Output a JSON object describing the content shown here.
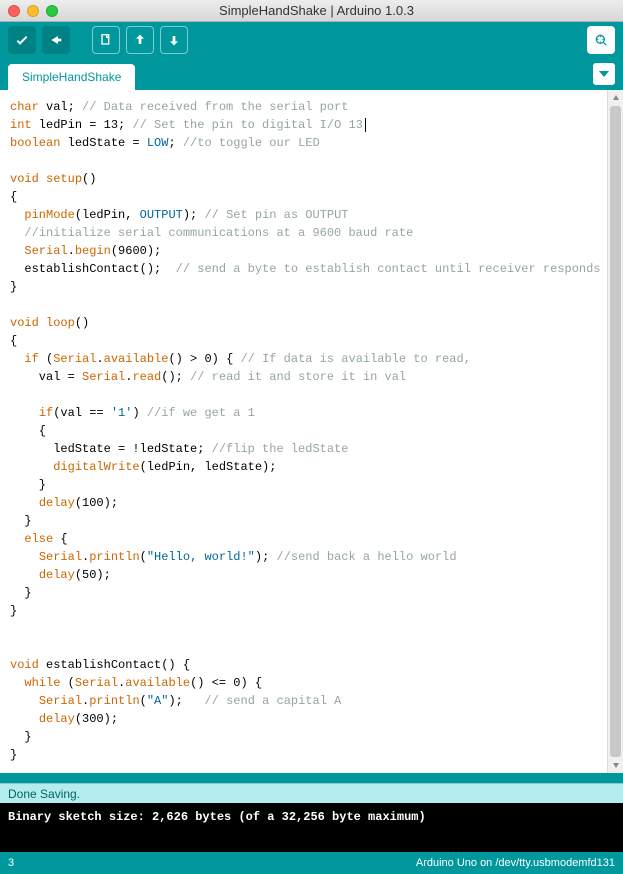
{
  "window": {
    "title": "SimpleHandShake | Arduino 1.0.3"
  },
  "tab": {
    "name": "SimpleHandShake"
  },
  "code": {
    "l1a": "char",
    "l1b": " val; ",
    "l1c": "// Data received from the serial port",
    "l2a": "int",
    "l2b": " ledPin = ",
    "l2c": "13",
    "l2d": "; ",
    "l2e": "// Set the pin to digital I/O 13",
    "l3a": "boolean",
    "l3b": " ledState = ",
    "l3c": "LOW",
    "l3d": "; ",
    "l3e": "//to toggle our LED",
    "l5a": "void",
    "l5b": " ",
    "l5c": "setup",
    "l5d": "()",
    "l6": "{",
    "l7a": "  ",
    "l7b": "pinMode",
    "l7c": "(ledPin, ",
    "l7d": "OUTPUT",
    "l7e": "); ",
    "l7f": "// Set pin as OUTPUT",
    "l8a": "  ",
    "l8b": "//initialize serial communications at a 9600 baud rate",
    "l9a": "  ",
    "l9b": "Serial",
    "l9c": ".",
    "l9d": "begin",
    "l9e": "(9600);",
    "l10a": "  establishContact();  ",
    "l10b": "// send a byte to establish contact until receiver responds",
    "l11": "}",
    "l13a": "void",
    "l13b": " ",
    "l13c": "loop",
    "l13d": "()",
    "l14": "{",
    "l15a": "  ",
    "l15b": "if",
    "l15c": " (",
    "l15d": "Serial",
    "l15e": ".",
    "l15f": "available",
    "l15g": "() > 0) { ",
    "l15h": "// If data is available to read,",
    "l16a": "    val = ",
    "l16b": "Serial",
    "l16c": ".",
    "l16d": "read",
    "l16e": "(); ",
    "l16f": "// read it and store it in val",
    "l18a": "    ",
    "l18b": "if",
    "l18c": "(val == ",
    "l18d": "'1'",
    "l18e": ") ",
    "l18f": "//if we get a 1",
    "l19": "    {",
    "l20a": "      ledState = !ledState; ",
    "l20b": "//flip the ledState",
    "l21a": "      ",
    "l21b": "digitalWrite",
    "l21c": "(ledPin, ledState);",
    "l22": "    }",
    "l23a": "    ",
    "l23b": "delay",
    "l23c": "(100);",
    "l24": "  }",
    "l25a": "  ",
    "l25b": "else",
    "l25c": " {",
    "l26a": "    ",
    "l26b": "Serial",
    "l26c": ".",
    "l26d": "println",
    "l26e": "(",
    "l26f": "\"Hello, world!\"",
    "l26g": "); ",
    "l26h": "//send back a hello world",
    "l27a": "    ",
    "l27b": "delay",
    "l27c": "(50);",
    "l28": "  }",
    "l29": "}",
    "l32a": "void",
    "l32b": " establishContact() {",
    "l33a": "  ",
    "l33b": "while",
    "l33c": " (",
    "l33d": "Serial",
    "l33e": ".",
    "l33f": "available",
    "l33g": "() <= 0) {",
    "l34a": "    ",
    "l34b": "Serial",
    "l34c": ".",
    "l34d": "println",
    "l34e": "(",
    "l34f": "\"A\"",
    "l34g": ");   ",
    "l34h": "// send a capital A",
    "l35a": "    ",
    "l35b": "delay",
    "l35c": "(300);",
    "l36": "  }",
    "l37": "}"
  },
  "status": {
    "message": "Done Saving."
  },
  "console": {
    "line1": "Binary sketch size: 2,626 bytes (of a 32,256 byte maximum)"
  },
  "footer": {
    "line": "3",
    "board": "Arduino Uno on /dev/tty.usbmodemfd131"
  }
}
